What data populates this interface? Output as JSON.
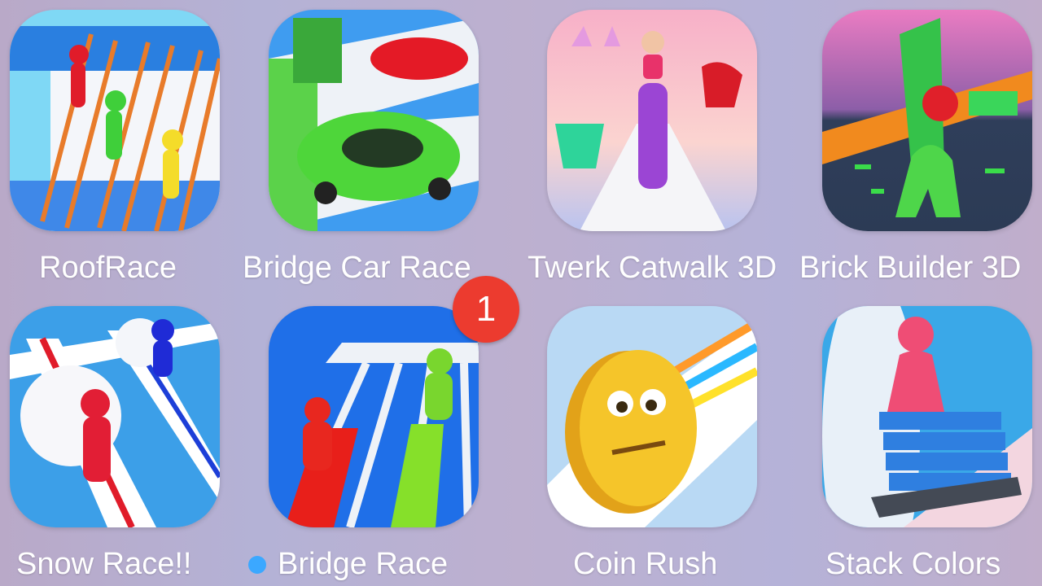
{
  "apps": [
    {
      "name": "RoofRace",
      "icon": "roofrace-app-icon"
    },
    {
      "name": "Bridge Car Race",
      "icon": "bridge-car-race-app-icon"
    },
    {
      "name": "Twerk Catwalk 3D",
      "icon": "twerk-catwalk-app-icon"
    },
    {
      "name": "Brick Builder 3D",
      "icon": "brick-builder-app-icon"
    },
    {
      "name": "Snow Race!!",
      "icon": "snow-race-app-icon"
    },
    {
      "name": "Bridge Race",
      "icon": "bridge-race-app-icon",
      "badge": "1",
      "new_install": true
    },
    {
      "name": "Coin Rush",
      "icon": "coin-rush-app-icon"
    },
    {
      "name": "Stack Colors",
      "icon": "stack-colors-app-icon"
    }
  ],
  "colors": {
    "badge": "#ec3b2f",
    "new_dot": "#3ba8ff"
  }
}
